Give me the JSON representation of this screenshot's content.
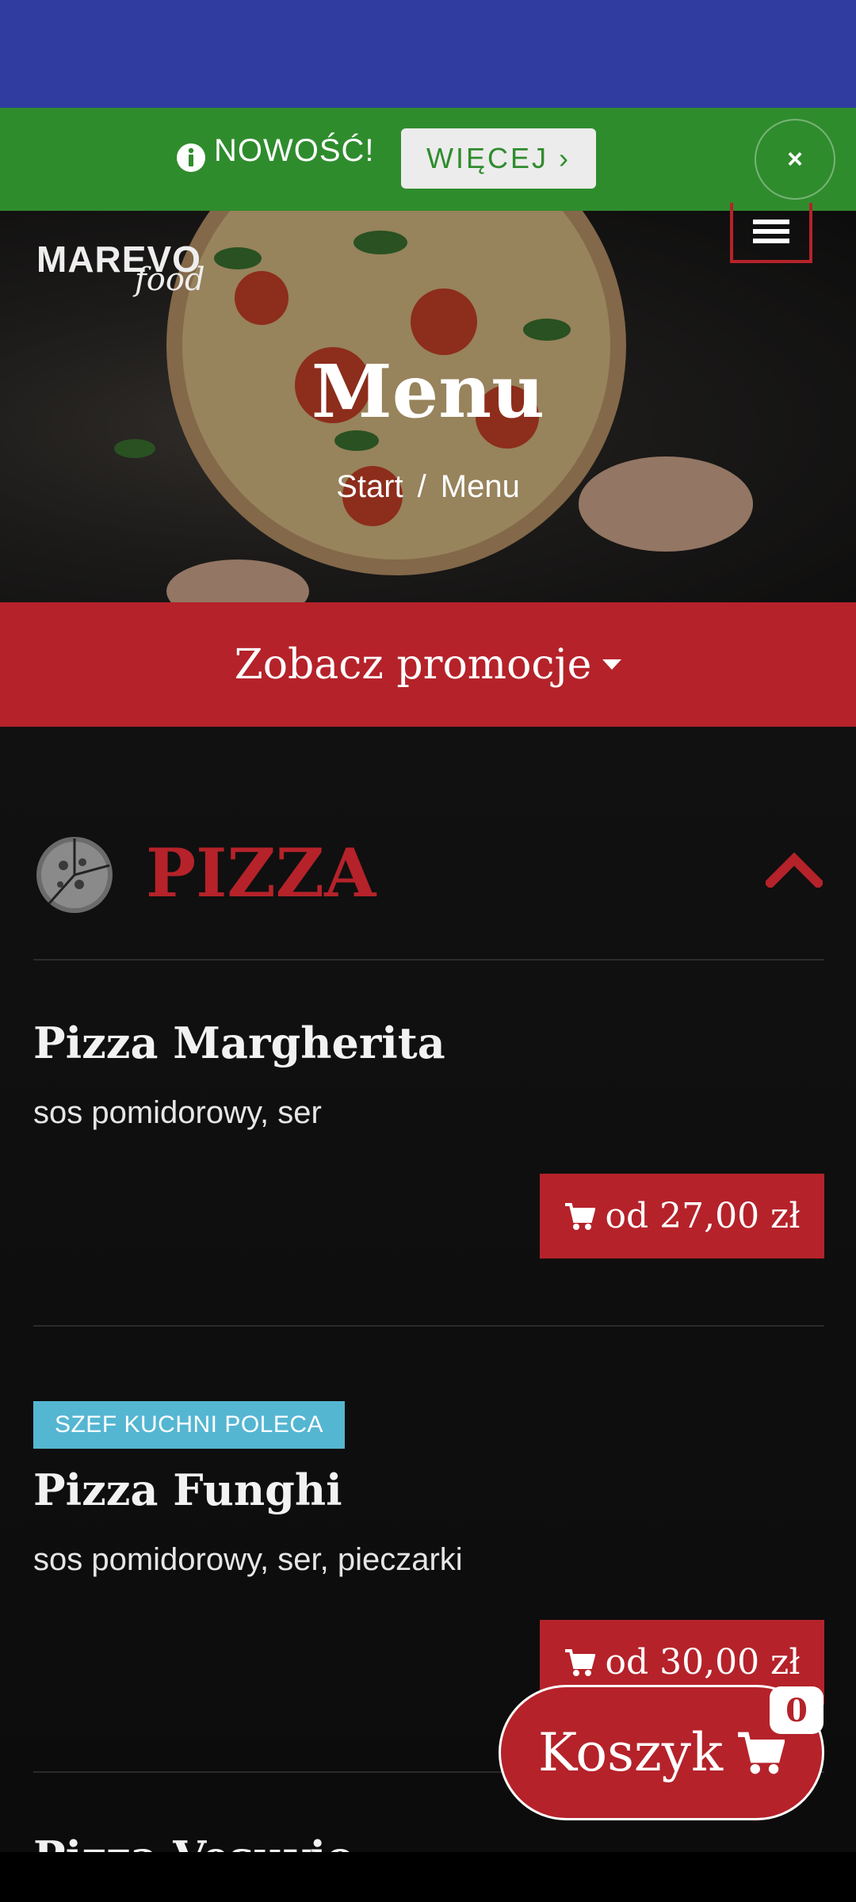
{
  "colors": {
    "accent": "#b5222a",
    "promo_green": "#2f8c2d",
    "status_blue": "#303c9f",
    "badge_blue": "#55b6d2"
  },
  "promo_bar": {
    "text": "NOWOŚĆ!",
    "more_label": "WIĘCEJ ›",
    "close_label": "×",
    "icon": "info-icon"
  },
  "header": {
    "logo_text": "MAREVO",
    "logo_sub": "food",
    "menu_icon": "hamburger-icon"
  },
  "hero": {
    "title": "Menu",
    "breadcrumb": [
      "Start",
      "Menu"
    ],
    "breadcrumb_sep": "/"
  },
  "promotions": {
    "label": "Zobacz promocje"
  },
  "category": {
    "title": "PIZZA",
    "icon": "pizza-icon",
    "collapse_icon": "chevron-up-icon"
  },
  "items": [
    {
      "name": "Pizza Margherita",
      "description": "sos pomidorowy, ser",
      "price": "od 27,00 zł"
    },
    {
      "badge": "SZEF KUCHNI POLECA",
      "name": "Pizza Funghi",
      "description": "sos pomidorowy, ser, pieczarki",
      "price": "od 30,00 zł"
    },
    {
      "name": "Pizza Vesuvio"
    }
  ],
  "cart": {
    "label": "Koszyk",
    "count": "0",
    "icon": "cart-icon"
  }
}
